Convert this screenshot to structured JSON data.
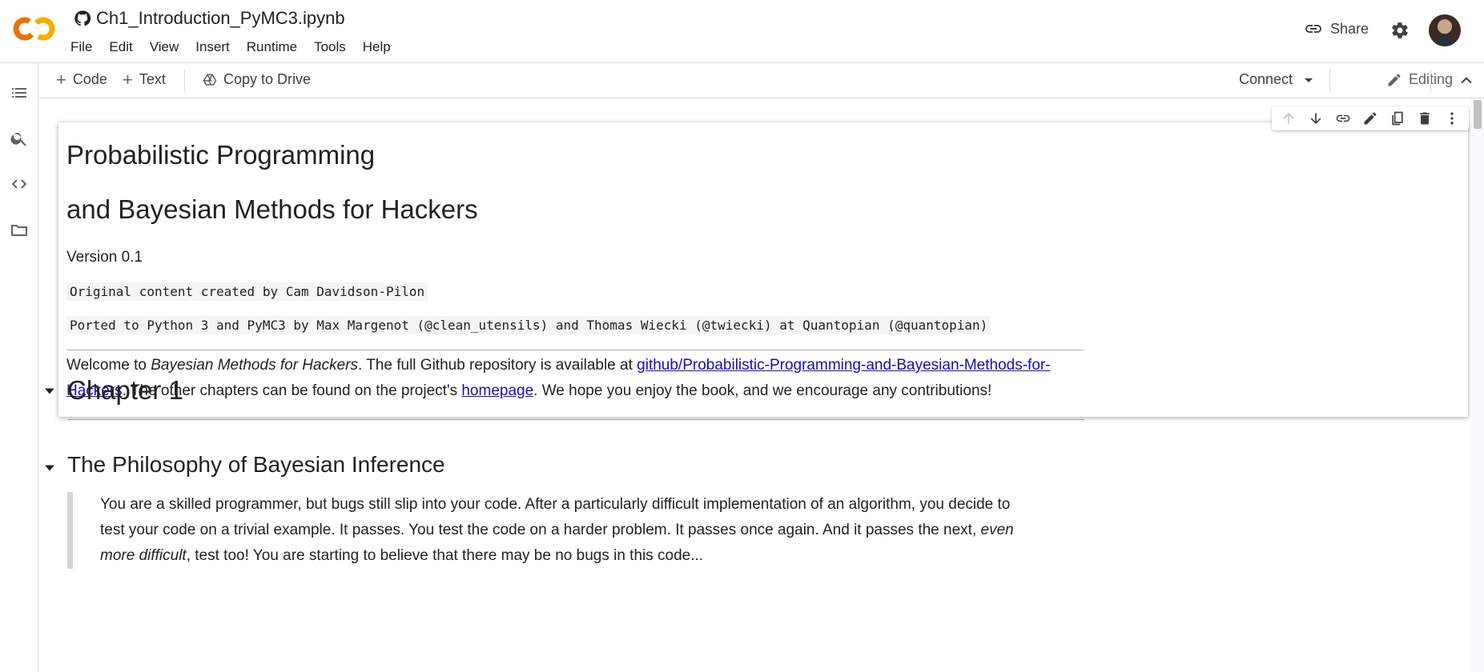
{
  "header": {
    "notebook_title": "Ch1_Introduction_PyMC3.ipynb",
    "menu": [
      "File",
      "Edit",
      "View",
      "Insert",
      "Runtime",
      "Tools",
      "Help"
    ],
    "share_label": "Share"
  },
  "toolbar": {
    "code_label": "Code",
    "text_label": "Text",
    "copy_drive_label": "Copy to Drive",
    "connect_label": "Connect",
    "editing_label": "Editing"
  },
  "cell": {
    "title_line1": "Probabilistic Programming",
    "title_line2": "and Bayesian Methods for Hackers",
    "version": "Version 0.1",
    "credit1": "Original content created by Cam Davidson-Pilon",
    "credit2": "Ported to Python 3 and PyMC3 by Max Margenot (@clean_utensils) and Thomas Wiecki (@twiecki) at Quantopian (@quantopian)",
    "welcome_prefix": "Welcome to ",
    "welcome_em": "Bayesian Methods for Hackers",
    "welcome_mid": ". The full Github repository is available at ",
    "repo_link": "github/Probabilistic-Programming-and-Bayesian-Methods-for-Hackers",
    "welcome_mid2": ". The other chapters can be found on the project's ",
    "homepage_link": "homepage",
    "welcome_suffix": ". We hope you enjoy the book, and we encourage any contributions!"
  },
  "chapter": {
    "heading": "Chapter 1",
    "subheading": "The Philosophy of Bayesian Inference",
    "quote_part1": "You are a skilled programmer, but bugs still slip into your code. After a particularly difficult implementation of an algorithm, you decide to test your code on a trivial example. It passes. You test the code on a harder problem. It passes once again. And it passes the next, ",
    "quote_em": "even more difficult",
    "quote_part2": ", test too! You are starting to believe that there may be no bugs in this code..."
  },
  "colors": {
    "logo_orange": "#F9AB00",
    "logo_dark_orange": "#E8710A",
    "link": "#1a0dab",
    "icon_gray": "#5f6368"
  },
  "icons": [
    "github-icon",
    "link-icon",
    "gear-icon",
    "toc-icon",
    "search-icon",
    "code-icon",
    "folder-icon",
    "drive-icon",
    "pencil-icon",
    "chevron-up-icon"
  ]
}
